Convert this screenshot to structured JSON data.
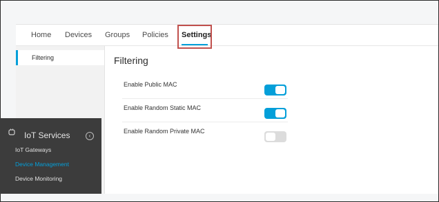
{
  "tabs": [
    {
      "label": "Home"
    },
    {
      "label": "Devices"
    },
    {
      "label": "Groups"
    },
    {
      "label": "Policies"
    },
    {
      "label": "Settings",
      "active": true
    }
  ],
  "subnav": {
    "items": [
      {
        "label": "Filtering",
        "active": true
      }
    ]
  },
  "content": {
    "title": "Filtering",
    "rows": [
      {
        "label": "Enable Public MAC",
        "enabled": true
      },
      {
        "label": "Enable Random Static MAC",
        "enabled": true
      },
      {
        "label": "Enable Random Private MAC",
        "enabled": false
      }
    ]
  },
  "flyout": {
    "icon": "iot-services-icon",
    "title": "IoT Services",
    "collapse_icon": "chevron-left-icon",
    "items": [
      {
        "label": "IoT Gateways",
        "active": false
      },
      {
        "label": "Device Management",
        "active": true
      },
      {
        "label": "Device Monitoring",
        "active": false
      }
    ]
  },
  "colors": {
    "accent": "#049fd9",
    "highlight": "#c0504d",
    "flyout_bg": "#3c3c3c"
  }
}
